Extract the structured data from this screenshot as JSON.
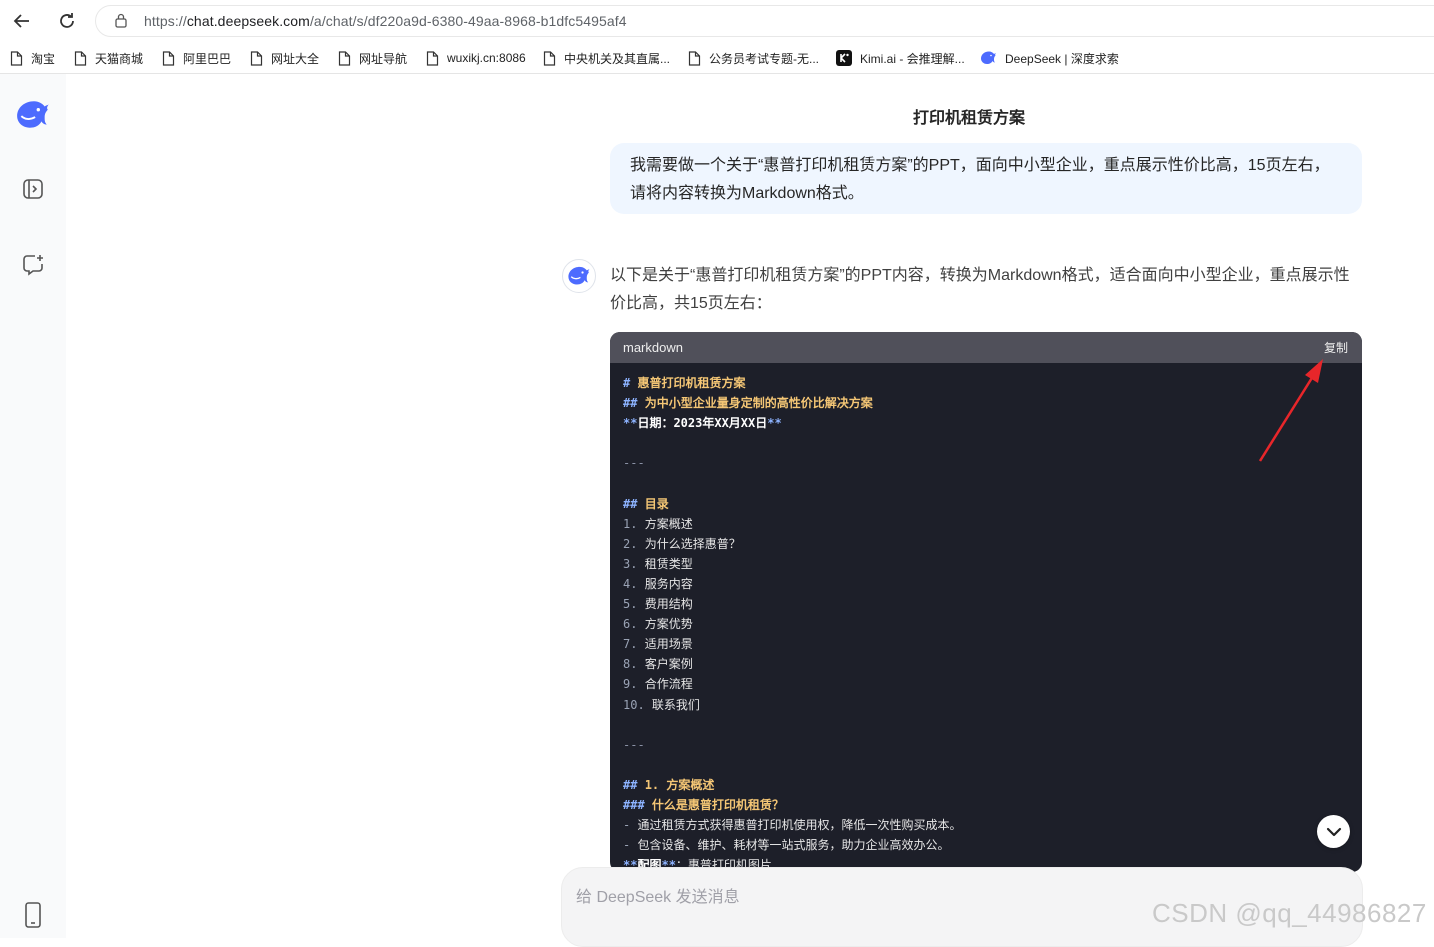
{
  "browser": {
    "url_prefix": "https://",
    "url_domain": "chat.deepseek.com",
    "url_path": "/a/chat/s/df220a9d-6380-49aa-8968-b1dfc5495af4"
  },
  "bookmarks": [
    {
      "label": "淘宝",
      "icon": "page-icon"
    },
    {
      "label": "天猫商城",
      "icon": "page-icon"
    },
    {
      "label": "阿里巴巴",
      "icon": "page-icon"
    },
    {
      "label": "网址大全",
      "icon": "page-icon"
    },
    {
      "label": "网址导航",
      "icon": "page-icon"
    },
    {
      "label": "wuxikj.cn:8086",
      "icon": "page-icon"
    },
    {
      "label": "中央机关及其直属...",
      "icon": "page-icon"
    },
    {
      "label": "公务员考试专题-无...",
      "icon": "page-icon"
    },
    {
      "label": "Kimi.ai - 会推理解...",
      "icon": "kimi-icon"
    },
    {
      "label": "DeepSeek | 深度求索",
      "icon": "deepseek-icon"
    }
  ],
  "conversation": {
    "title": "打印机租赁方案",
    "user_line1": "我需要做一个关于“惠普打印机租赁方案”的PPT，面向中小型企业，重点展示性价比高，15页左右，",
    "user_line2": "请将内容转换为Markdown格式。",
    "ai_line1": "以下是关于“惠普打印机租赁方案”的PPT内容，转换为Markdown格式，适合面向中小型企业，重点展示性",
    "ai_line2": "价比高，共15页左右："
  },
  "code_block": {
    "language": "markdown",
    "copy_label": "复制",
    "h1": "惠普打印机租赁方案",
    "h2": "为中小型企业量身定制的高性价比解决方案",
    "date": "日期：2023年XX月XX日",
    "hr": "---",
    "toc_title": "目录",
    "toc": [
      {
        "num": "1.",
        "text": "方案概述"
      },
      {
        "num": "2.",
        "text": "为什么选择惠普？"
      },
      {
        "num": "3.",
        "text": "租赁类型"
      },
      {
        "num": "4.",
        "text": "服务内容"
      },
      {
        "num": "5.",
        "text": "费用结构"
      },
      {
        "num": "6.",
        "text": "方案优势"
      },
      {
        "num": "7.",
        "text": "适用场景"
      },
      {
        "num": "8.",
        "text": "客户案例"
      },
      {
        "num": "9.",
        "text": "合作流程"
      },
      {
        "num": "10.",
        "text": "联系我们"
      }
    ],
    "sec1_title": "1. 方案概述",
    "sec1_sub": "什么是惠普打印机租赁？",
    "bullet1": "通过租赁方式获得惠普打印机使用权，降低一次性购买成本。",
    "bullet2": "包含设备、维护、耗材等一站式服务，助力企业高效办公。",
    "img_label": "配图",
    "img_text": "：惠普打印机图片"
  },
  "input": {
    "placeholder": "给 DeepSeek 发送消息"
  },
  "watermark": "CSDN @qq_44986827",
  "colors": {
    "brand": "#4d6bfe",
    "user_bubble": "#eff6ff",
    "code_bg": "#1d1f29",
    "code_header": "#50505a",
    "annotation_arrow": "#e8262a"
  }
}
